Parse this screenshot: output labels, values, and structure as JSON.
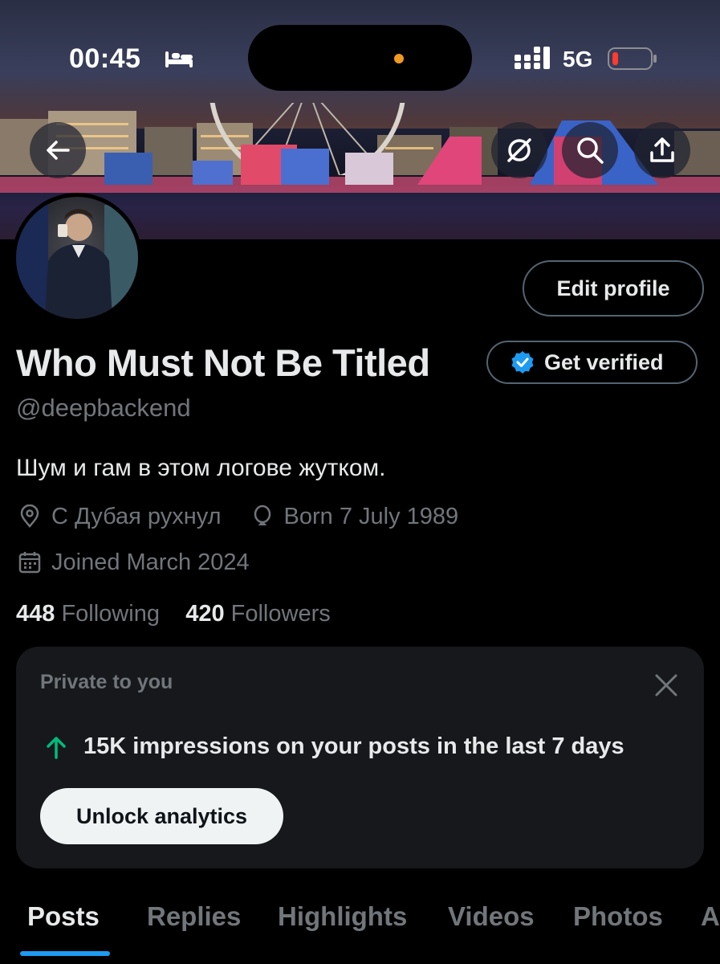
{
  "status_bar": {
    "time": "00:45",
    "network": "5G",
    "icons": [
      "bed-icon",
      "signal-icon",
      "battery-icon"
    ]
  },
  "banner": {
    "icons": [
      "back-arrow-icon",
      "grok-icon",
      "search-icon",
      "share-icon"
    ]
  },
  "profile": {
    "edit_profile_label": "Edit profile",
    "display_name": "Who Must Not Be Titled",
    "get_verified_label": "Get verified",
    "handle": "@deepbackend",
    "bio": "Шум и гам в этом логове жутком.",
    "location": "С Дубая рухнул",
    "birthday": "Born 7 July 1989",
    "joined": "Joined March 2024",
    "following_count": "448",
    "following_label": "Following",
    "followers_count": "420",
    "followers_label": "Followers"
  },
  "analytics_card": {
    "title": "Private to you",
    "stat_text": "15K impressions on your posts in the last 7 days",
    "button_label": "Unlock analytics"
  },
  "tabs": [
    {
      "label": "Posts",
      "active": true
    },
    {
      "label": "Replies",
      "active": false
    },
    {
      "label": "Highlights",
      "active": false
    },
    {
      "label": "Videos",
      "active": false
    },
    {
      "label": "Photos",
      "active": false
    },
    {
      "label": "A",
      "active": false
    }
  ],
  "colors": {
    "background": "#000000",
    "primary_text": "#e7e9ea",
    "secondary_text": "#71767b",
    "accent_blue": "#1d9bf0",
    "card_bg": "#16181c",
    "stat_green": "#00ba7c",
    "battery_red": "#ff3b30"
  }
}
